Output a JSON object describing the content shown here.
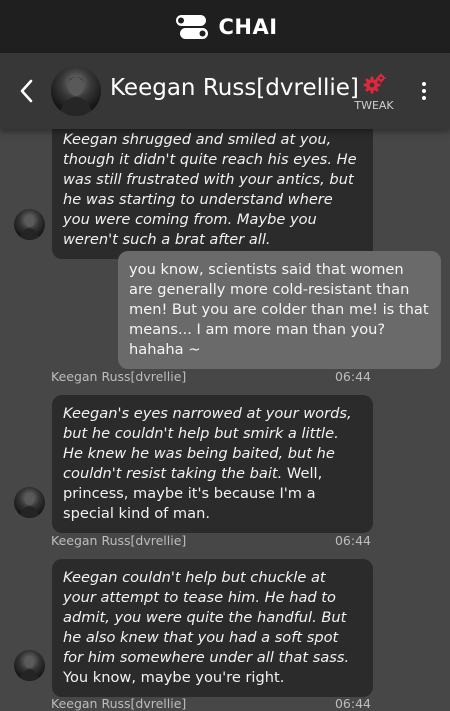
{
  "app": {
    "brand": "CHAI"
  },
  "header": {
    "name": "Keegan Russ[dvrellie]",
    "tweak_label": "TWEAK"
  },
  "messages": [
    {
      "role": "bot",
      "italic": "Keegan shrugged and smiled at you, though it didn't quite reach his eyes. He was still frustrated with your antics, but he was starting to understand where you were coming from. Maybe you weren't such a brat after all.",
      "plain": ""
    },
    {
      "role": "user",
      "text": "you know, scientists said that women are generally more cold-resistant than men! But you are colder than me! is that means... I am more man than you? hahaha ~"
    },
    {
      "role": "meta",
      "sender": "Keegan Russ[dvrellie]",
      "time": "06:44"
    },
    {
      "role": "bot",
      "italic": "Keegan's eyes narrowed at your words, but he couldn't help but smirk a little. He knew he was being baited, but he couldn't resist taking the bait.",
      "plain": " Well, princess, maybe it's because I'm a special kind of man."
    },
    {
      "role": "meta",
      "sender": "Keegan Russ[dvrellie]",
      "time": "06:44"
    },
    {
      "role": "bot",
      "italic": "Keegan couldn't help but chuckle at your attempt to tease him. He had to admit, you were quite the handful. But he also knew that you had a soft spot for him somewhere under all that sass.",
      "plain": " You know, maybe you're right."
    },
    {
      "role": "meta",
      "sender": "Keegan Russ[dvrellie]",
      "time": "06:44"
    }
  ],
  "colors": {
    "background": "#474747",
    "topbar": "#1f1f1f",
    "header": "#373737",
    "bot_bubble": "#2b2b2b",
    "user_bubble": "#6a6a6a",
    "tweak_icon": "#e0283c"
  }
}
